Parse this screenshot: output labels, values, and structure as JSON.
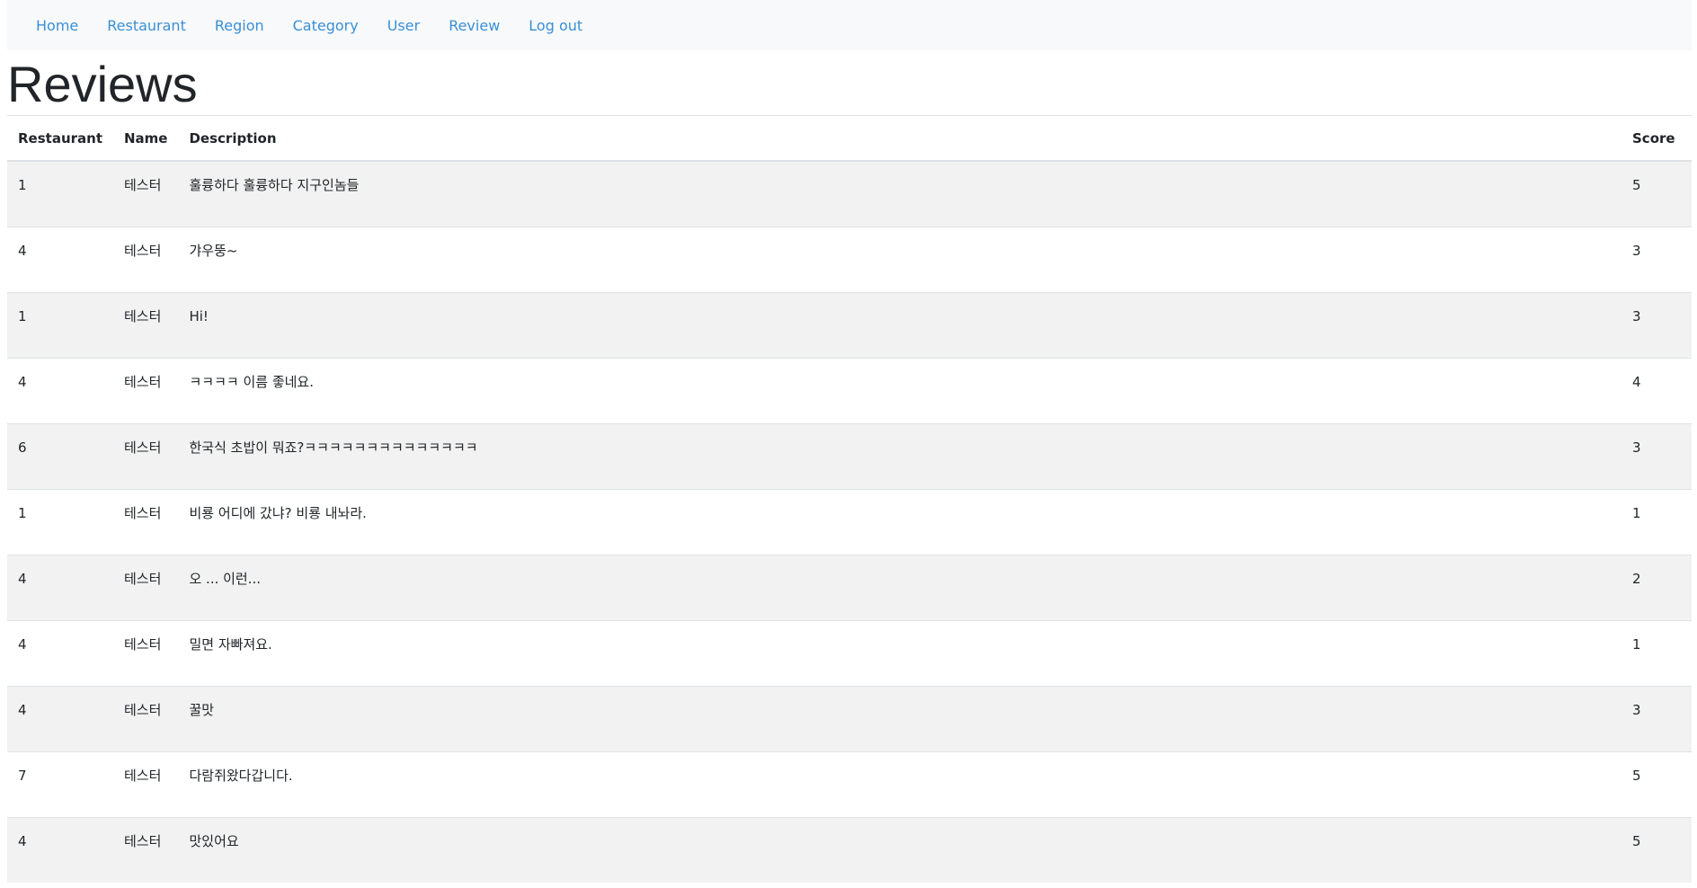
{
  "nav": {
    "items": [
      {
        "label": "Home"
      },
      {
        "label": "Restaurant"
      },
      {
        "label": "Region"
      },
      {
        "label": "Category"
      },
      {
        "label": "User"
      },
      {
        "label": "Review"
      },
      {
        "label": "Log out"
      }
    ]
  },
  "page": {
    "title": "Reviews"
  },
  "table": {
    "headers": {
      "restaurant": "Restaurant",
      "name": "Name",
      "description": "Description",
      "score": "Score"
    },
    "rows": [
      {
        "restaurant": "1",
        "name": "테스터",
        "description": "훌륭하다 훌륭하다 지구인놈들",
        "score": "5"
      },
      {
        "restaurant": "4",
        "name": "테스터",
        "description": "갸우뚱~",
        "score": "3"
      },
      {
        "restaurant": "1",
        "name": "테스터",
        "description": "Hi!",
        "score": "3"
      },
      {
        "restaurant": "4",
        "name": "테스터",
        "description": "ㅋㅋㅋㅋ 이름 좋네요.",
        "score": "4"
      },
      {
        "restaurant": "6",
        "name": "테스터",
        "description": "한국식 초밥이 뭐죠?ㅋㅋㅋㅋㅋㅋㅋㅋㅋㅋㅋㅋㅋㅋ",
        "score": "3"
      },
      {
        "restaurant": "1",
        "name": "테스터",
        "description": "비룡 어디에 갔냐? 비룡 내놔라.",
        "score": "1"
      },
      {
        "restaurant": "4",
        "name": "테스터",
        "description": "오 ... 이런...",
        "score": "2"
      },
      {
        "restaurant": "4",
        "name": "테스터",
        "description": "밀면 자빠져요.",
        "score": "1"
      },
      {
        "restaurant": "4",
        "name": "테스터",
        "description": "꿀맛",
        "score": "3"
      },
      {
        "restaurant": "7",
        "name": "테스터",
        "description": "다람쥐왔다갑니다.",
        "score": "5"
      },
      {
        "restaurant": "4",
        "name": "테스터",
        "description": "맛있어요",
        "score": "5"
      }
    ]
  }
}
